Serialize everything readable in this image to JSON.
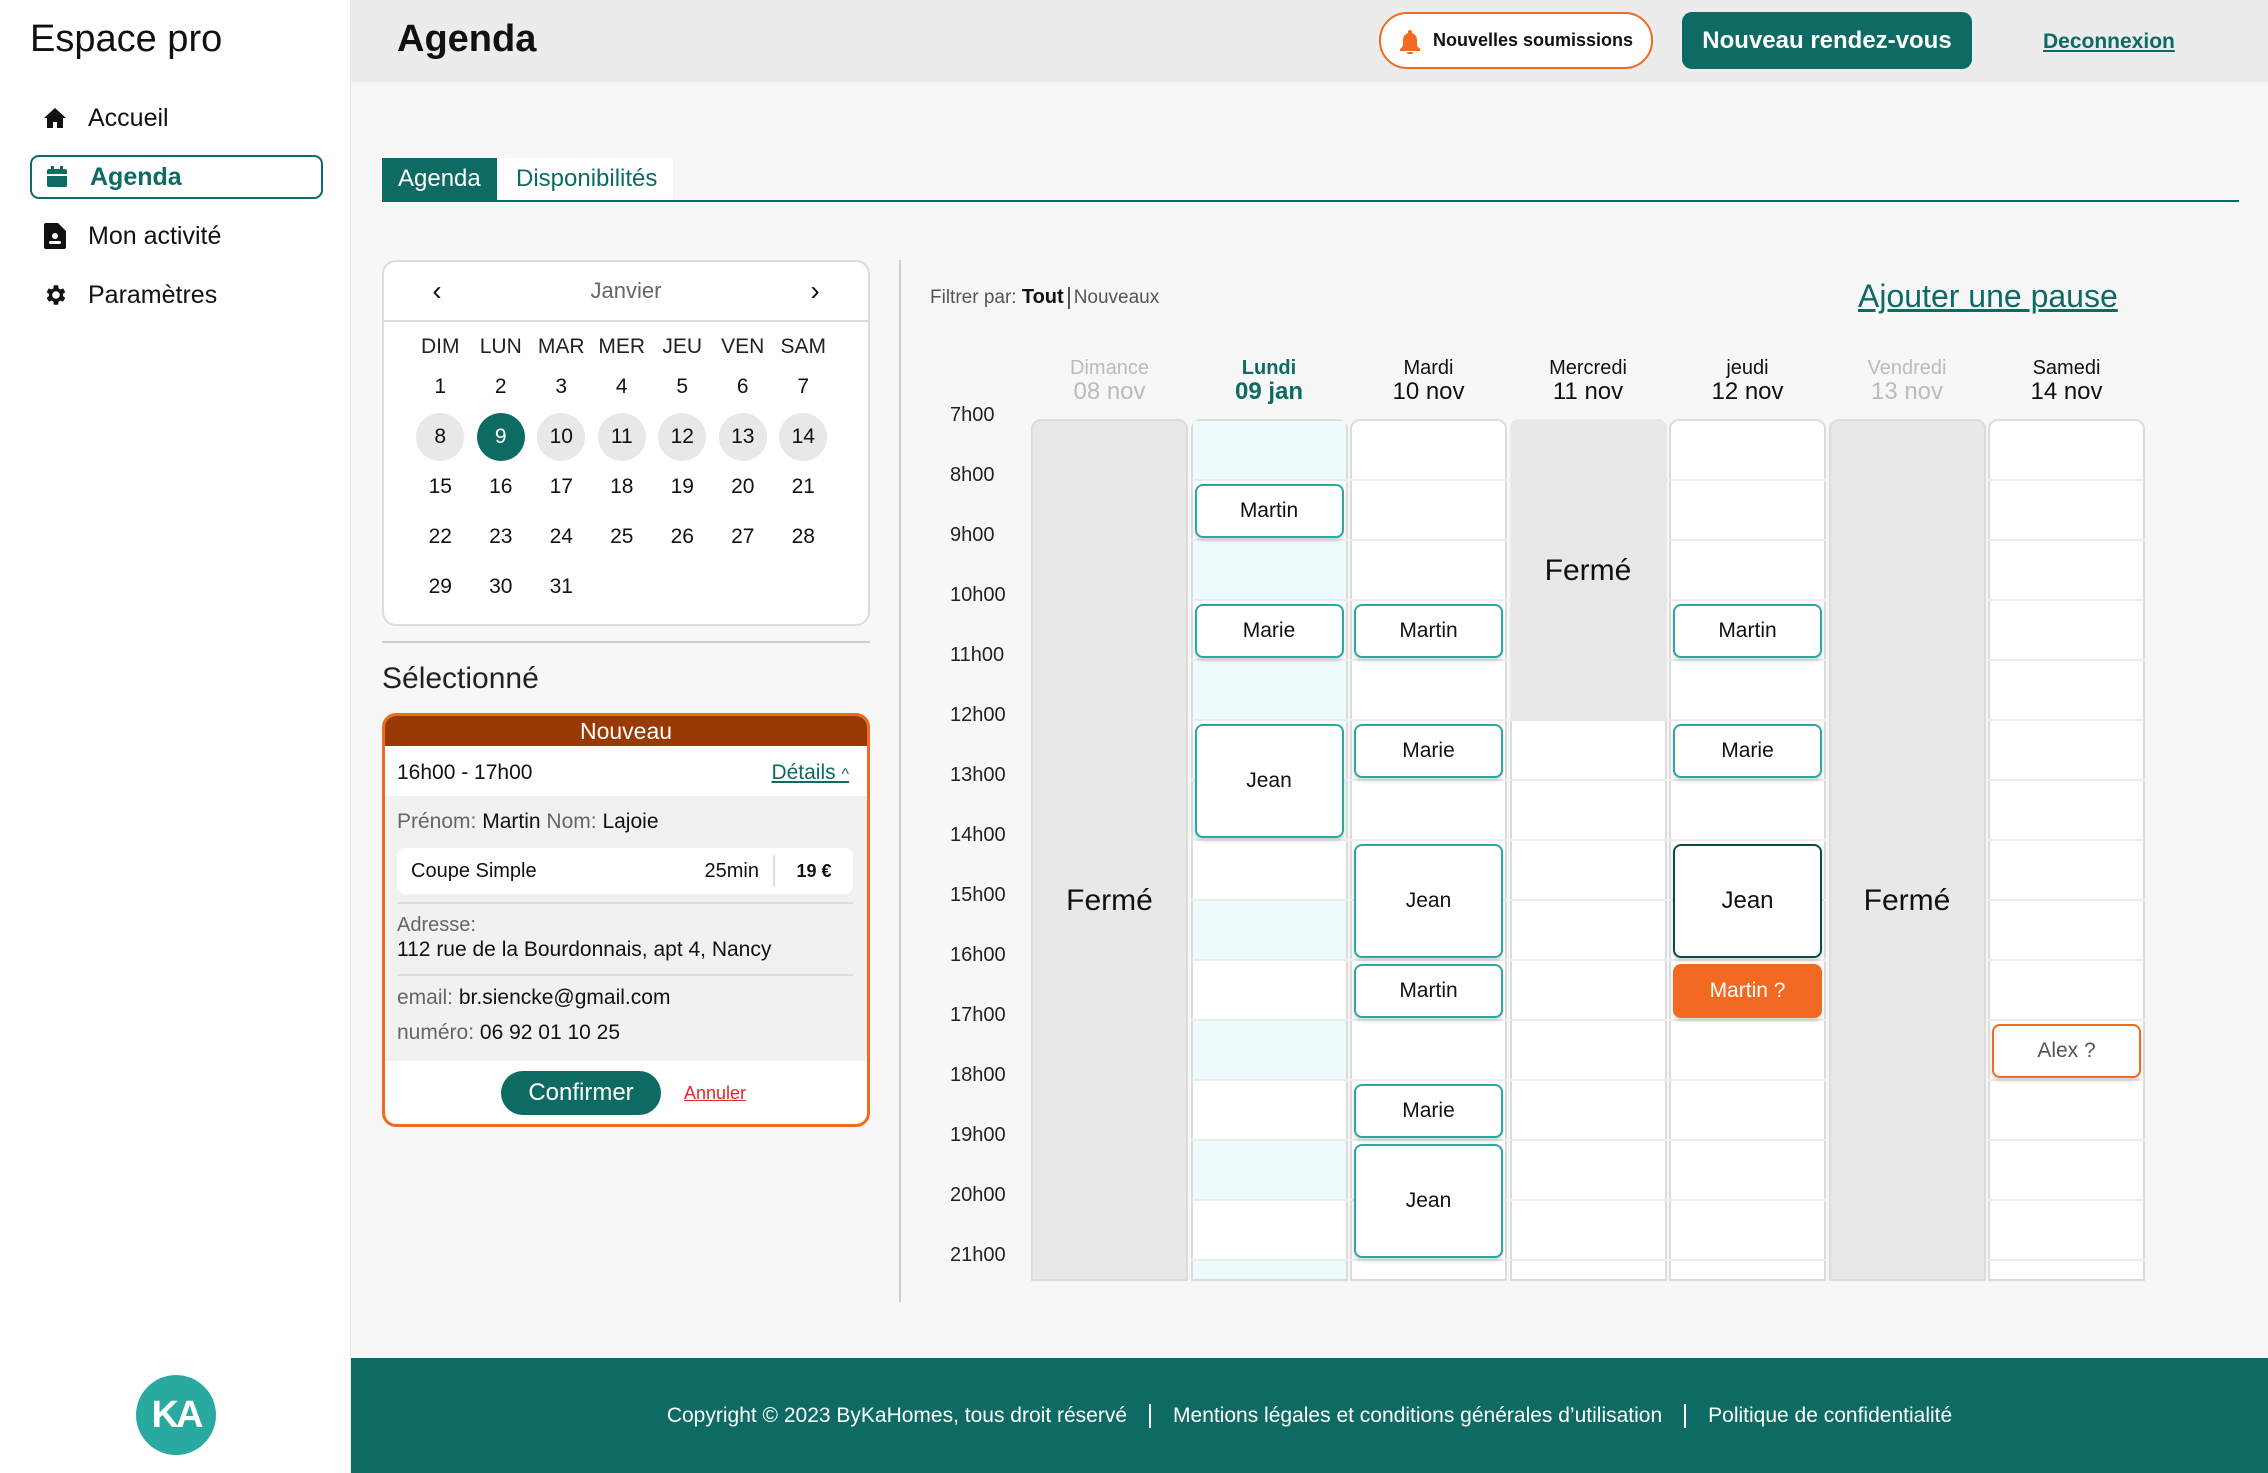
{
  "sidebar": {
    "brand": "Espace pro",
    "items": [
      {
        "label": "Accueil",
        "icon": "home-icon"
      },
      {
        "label": "Agenda",
        "icon": "calendar-icon",
        "active": true
      },
      {
        "label": "Mon activité",
        "icon": "document-icon"
      },
      {
        "label": "Paramètres",
        "icon": "gear-icon"
      }
    ],
    "logo_text": "KA"
  },
  "header": {
    "title": "Agenda",
    "submissions_label": "Nouvelles soumissions",
    "new_appointment_label": "Nouveau rendez-vous",
    "logout_label": "Deconnexion"
  },
  "tabs": [
    {
      "label": "Agenda",
      "active": true
    },
    {
      "label": "Disponibilités",
      "active": false
    }
  ],
  "mini_calendar": {
    "month": "Janvier",
    "weekdays": [
      "DIM",
      "LUN",
      "MAR",
      "MER",
      "JEU",
      "VEN",
      "SAM"
    ],
    "weeks": [
      [
        "1",
        "2",
        "3",
        "4",
        "5",
        "6",
        "7"
      ],
      [
        "8",
        "9",
        "10",
        "11",
        "12",
        "13",
        "14"
      ],
      [
        "15",
        "16",
        "17",
        "18",
        "19",
        "20",
        "21"
      ],
      [
        "22",
        "23",
        "24",
        "25",
        "26",
        "27",
        "28"
      ],
      [
        "29",
        "30",
        "31",
        "",
        "",
        "",
        ""
      ]
    ],
    "selected_day": "9",
    "highlighted_week": 1
  },
  "selected": {
    "title": "Sélectionné",
    "status": "Nouveau",
    "time": "16h00 - 17h00",
    "details_label": "Détails",
    "first_name_label": "Prénom:",
    "first_name": "Martin",
    "last_name_label": "Nom:",
    "last_name": "Lajoie",
    "service": "Coupe Simple",
    "duration": "25min",
    "price": "19 €",
    "address_label": "Adresse:",
    "address": "112 rue de la Bourdonnais, apt 4, Nancy",
    "email_label": "email:",
    "email": "br.siencke@gmail.com",
    "phone_label": "numéro:",
    "phone": "06 92 01 10 25",
    "confirm_label": "Confirmer",
    "cancel_label": "Annuler"
  },
  "filter": {
    "label": "Filtrer par:",
    "options": [
      "Tout",
      "Nouveaux"
    ],
    "active": "Tout"
  },
  "add_pause_label": "Ajouter une pause",
  "hours": [
    "7h00",
    "8h00",
    "9h00",
    "10h00",
    "11h00",
    "12h00",
    "13h00",
    "14h00",
    "15h00",
    "16h00",
    "17h00",
    "18h00",
    "19h00",
    "20h00",
    "21h00"
  ],
  "days": [
    {
      "name": "Dimance",
      "date": "08 nov",
      "state": "closed",
      "closed_label": "Fermé",
      "closed_from": 7,
      "closed_to": 21.5,
      "appointments": []
    },
    {
      "name": "Lundi",
      "date": "09 jan",
      "state": "today",
      "appointments": [
        {
          "name": "Martin",
          "start": 8,
          "end": 9
        },
        {
          "name": "Marie",
          "start": 10,
          "end": 11
        },
        {
          "name": "Jean",
          "start": 12,
          "end": 14
        }
      ]
    },
    {
      "name": "Mardi",
      "date": "10 nov",
      "state": "open",
      "appointments": [
        {
          "name": "Martin",
          "start": 10,
          "end": 11
        },
        {
          "name": "Marie",
          "start": 12,
          "end": 13
        },
        {
          "name": "Jean",
          "start": 14,
          "end": 16
        },
        {
          "name": "Martin",
          "start": 16,
          "end": 17
        },
        {
          "name": "Marie",
          "start": 18,
          "end": 19
        },
        {
          "name": "Jean",
          "start": 19,
          "end": 21
        }
      ]
    },
    {
      "name": "Mercredi",
      "date": "11 nov",
      "state": "partial",
      "closed_label": "Fermé",
      "closed_from": 7,
      "closed_to": 12,
      "appointments": []
    },
    {
      "name": "jeudi",
      "date": "12 nov",
      "state": "open",
      "appointments": [
        {
          "name": "Martin",
          "start": 10,
          "end": 11
        },
        {
          "name": "Marie",
          "start": 12,
          "end": 13
        },
        {
          "name": "Jean",
          "start": 14,
          "end": 16,
          "style": "strong"
        },
        {
          "name": "Martin ?",
          "start": 16,
          "end": 17,
          "style": "pending"
        }
      ]
    },
    {
      "name": "Vendredi",
      "date": "13 nov",
      "state": "closed",
      "closed_label": "Fermé",
      "closed_from": 7,
      "closed_to": 21.5,
      "appointments": []
    },
    {
      "name": "Samedi",
      "date": "14 nov",
      "state": "open",
      "appointments": [
        {
          "name": "Alex ?",
          "start": 17,
          "end": 18,
          "style": "pending-outline"
        }
      ]
    }
  ],
  "footer": {
    "copyright": "Copyright © 2023 ByKaHomes, tous droit réservé",
    "legal": "Mentions légales et conditions générales d’utilisation",
    "privacy": "Politique de confidentialité"
  },
  "colors": {
    "primary": "#0d6b63",
    "accent": "#f26a21",
    "teal_light": "#2aa9a0",
    "status_header": "#973a05",
    "closed_bg": "#e8e8e8"
  }
}
